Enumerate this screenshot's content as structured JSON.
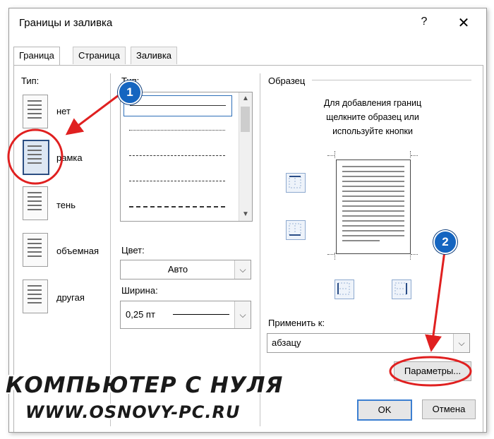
{
  "dialog": {
    "title": "Границы и заливка",
    "help": "?",
    "close": "✕"
  },
  "tabs": [
    {
      "label": "Граница"
    },
    {
      "label": "Страница"
    },
    {
      "label": "Заливка"
    }
  ],
  "border_type": {
    "label": "Тип:",
    "options": [
      {
        "label": "нет"
      },
      {
        "label": "рамка"
      },
      {
        "label": "тень"
      },
      {
        "label": "объемная"
      },
      {
        "label": "другая"
      }
    ]
  },
  "line_style": {
    "label": "Тип:",
    "items": [
      "solid",
      "dotted",
      "dashed-small",
      "dashed",
      "dash-long"
    ]
  },
  "color": {
    "label": "Цвет:",
    "value": "Авто"
  },
  "width": {
    "label": "Ширина:",
    "value": "0,25 пт"
  },
  "preview": {
    "label": "Образец",
    "hint_line1": "Для добавления границ",
    "hint_line2": "щелкните образец или",
    "hint_line3": "используйте кнопки"
  },
  "apply_to": {
    "label": "Применить к:",
    "value": "абзацу"
  },
  "buttons": {
    "options": "Параметры...",
    "ok": "OK",
    "cancel": "Отмена"
  },
  "annotations": {
    "marker1": "1",
    "marker2": "2",
    "marker_color": "#1565c0",
    "highlight_color": "#e02020"
  },
  "watermark": {
    "line1": "КОМПЬЮТЕР С НУЛЯ",
    "line2": "WWW.OSNOVY-PC.RU"
  }
}
